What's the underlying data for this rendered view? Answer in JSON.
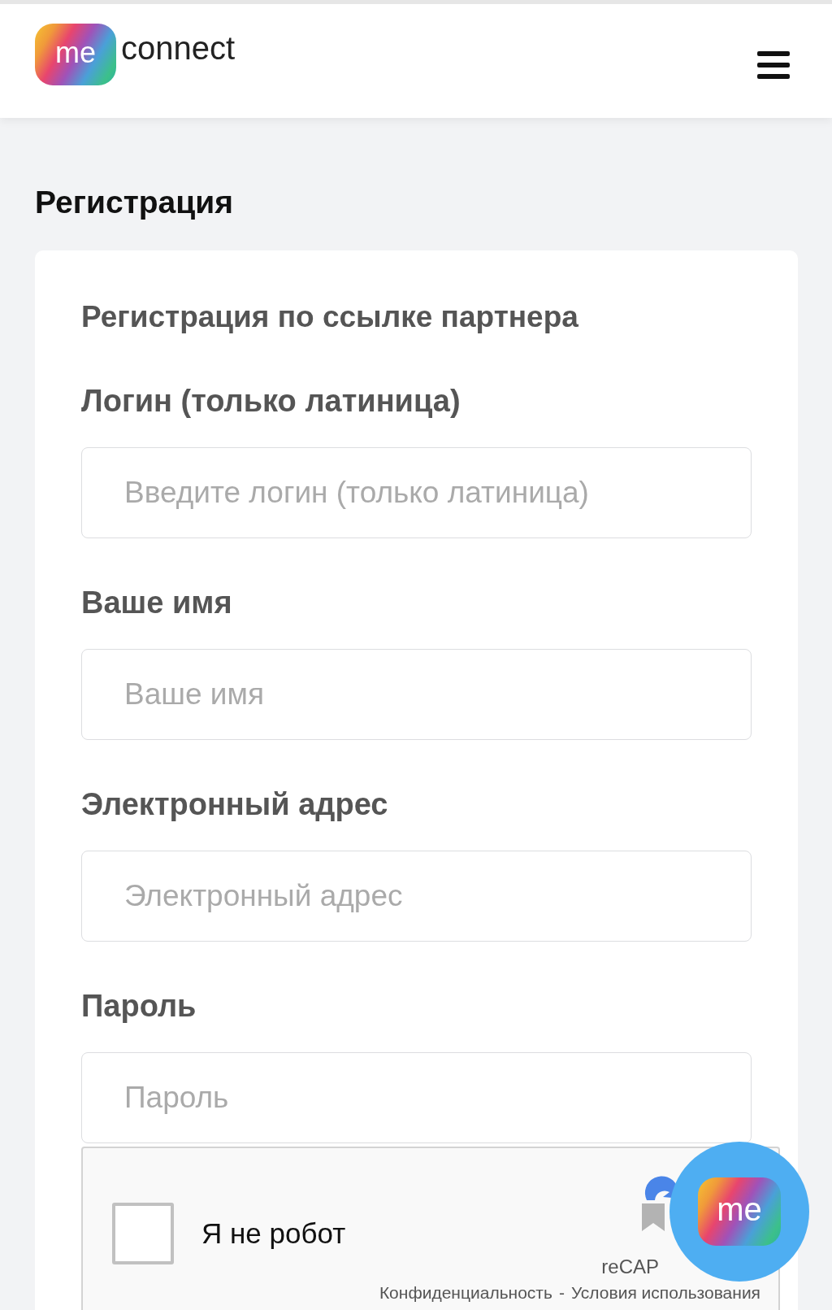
{
  "header": {
    "logo": {
      "badge": "me",
      "wordmark": "connect"
    }
  },
  "page_title": "Регистрация",
  "form": {
    "subtitle": "Регистрация по ссылке партнера",
    "fields": [
      {
        "label": "Логин (только латиница)",
        "placeholder": "Введите логин (только латиница)"
      },
      {
        "label": "Ваше имя",
        "placeholder": "Ваше имя"
      },
      {
        "label": "Электронный адрес",
        "placeholder": "Электронный адрес"
      },
      {
        "label": "Пароль",
        "placeholder": "Пароль"
      }
    ],
    "captcha": {
      "checked": false,
      "label": "Я не робот",
      "brand": "reCAP",
      "links": [
        "Конфиденциальность",
        "Условия использования"
      ],
      "separator": "-"
    }
  },
  "chat_button": {
    "badge": "me"
  }
}
